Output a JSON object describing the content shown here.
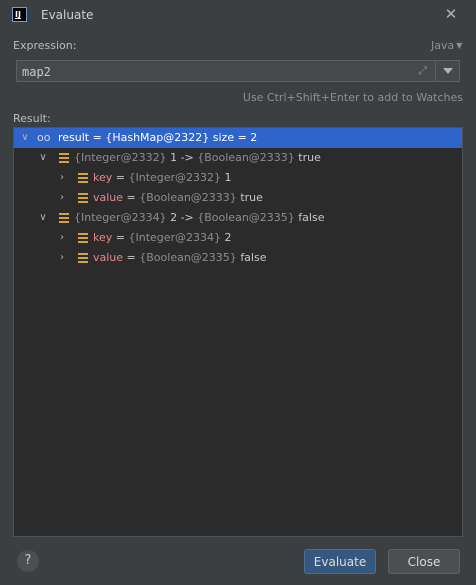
{
  "window": {
    "title": "Evaluate"
  },
  "expression": {
    "label": "Expression:",
    "value": "map2",
    "language": "Java",
    "hint": "Use Ctrl+Shift+Enter to add to Watches"
  },
  "result": {
    "label": "Result:",
    "root": {
      "prefix": "result = ",
      "type": "{HashMap@2322}",
      "suffix": "  size = 2"
    },
    "entries": [
      {
        "key_type": "{Integer@2332}",
        "key_val": "1",
        "arrow": "->",
        "val_type": "{Boolean@2333}",
        "val_val": "true",
        "key_row": {
          "name": "key",
          "eq": " = ",
          "type": "{Integer@2332}",
          "val": "1"
        },
        "value_row": {
          "name": "value",
          "eq": " = ",
          "type": "{Boolean@2333}",
          "val": "true"
        }
      },
      {
        "key_type": "{Integer@2334}",
        "key_val": "2",
        "arrow": "->",
        "val_type": "{Boolean@2335}",
        "val_val": "false",
        "key_row": {
          "name": "key",
          "eq": " = ",
          "type": "{Integer@2334}",
          "val": "2"
        },
        "value_row": {
          "name": "value",
          "eq": " = ",
          "type": "{Boolean@2335}",
          "val": "false"
        }
      }
    ]
  },
  "buttons": {
    "help": "?",
    "evaluate": "Evaluate",
    "close": "Close"
  },
  "icons": {
    "app": "intellij-app-icon",
    "close": "close-icon",
    "glasses": "watch-glasses-icon",
    "field": "field-icon",
    "expand": "expand-icon",
    "dropdown": "chevron-down-icon"
  },
  "colors": {
    "selection": "#2f65ca",
    "primary_button": "#365880",
    "key_name": "#e38888",
    "field_icon": "#d5a33c"
  }
}
